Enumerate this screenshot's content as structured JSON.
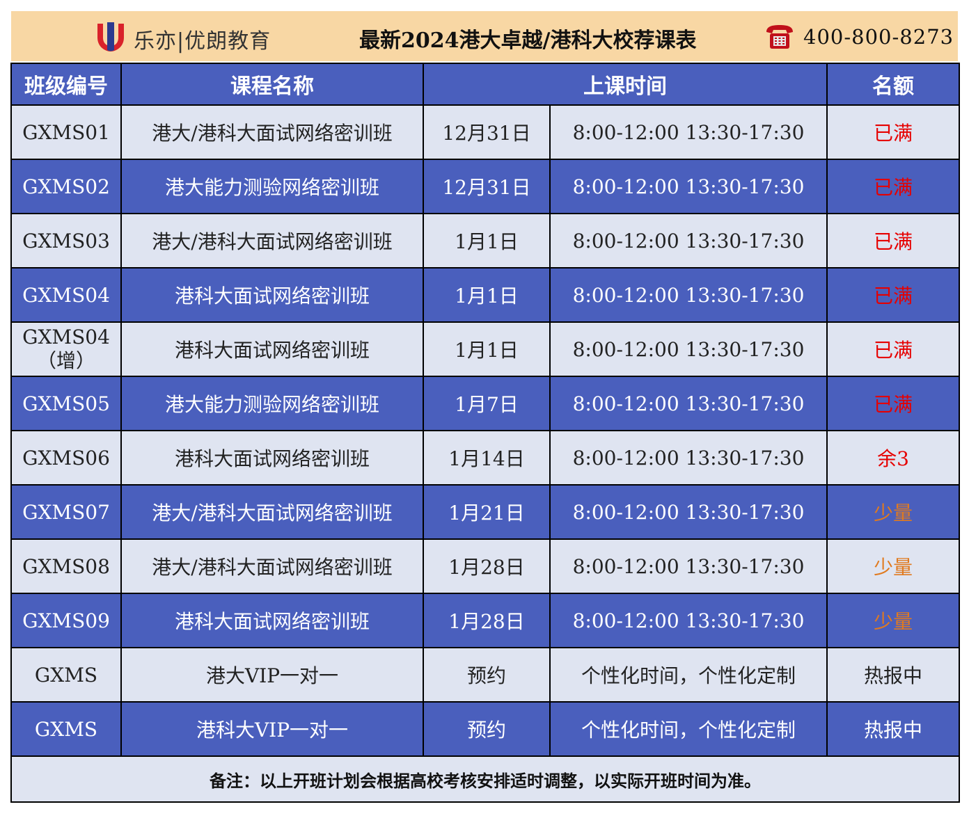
{
  "header": {
    "logo_text": "乐亦|优朗教育",
    "title": "最新2024港大卓越/港科大校荐课表",
    "phone": "400-800-8273",
    "icons": [
      "logo-icon",
      "telephone-icon"
    ]
  },
  "colors": {
    "header_bg": "#f8d7a4",
    "dark_row": "#4a5fbd",
    "light_row": "#dfe4f1",
    "status_full": "#e60000",
    "status_few": "#e07a1f"
  },
  "table": {
    "headers": [
      "班级编号",
      "课程名称",
      "上课时间",
      "名额"
    ],
    "rows": [
      {
        "id": "GXMS01",
        "id_sub": "",
        "course": "港大/港科大面试网络密训班",
        "date": "12月31日",
        "time": "8:00-12:00 13:30-17:30",
        "quota": "已满"
      },
      {
        "id": "GXMS02",
        "id_sub": "",
        "course": "港大能力测验网络密训班",
        "date": "12月31日",
        "time": "8:00-12:00 13:30-17:30",
        "quota": "已满"
      },
      {
        "id": "GXMS03",
        "id_sub": "",
        "course": "港大/港科大面试网络密训班",
        "date": "1月1日",
        "time": "8:00-12:00 13:30-17:30",
        "quota": "已满"
      },
      {
        "id": "GXMS04",
        "id_sub": "",
        "course": "港科大面试网络密训班",
        "date": "1月1日",
        "time": "8:00-12:00 13:30-17:30",
        "quota": "已满"
      },
      {
        "id": "GXMS04",
        "id_sub": "（增）",
        "course": "港科大面试网络密训班",
        "date": "1月1日",
        "time": "8:00-12:00 13:30-17:30",
        "quota": "已满"
      },
      {
        "id": "GXMS05",
        "id_sub": "",
        "course": "港大能力测验网络密训班",
        "date": "1月7日",
        "time": "8:00-12:00 13:30-17:30",
        "quota": "已满"
      },
      {
        "id": "GXMS06",
        "id_sub": "",
        "course": "港科大面试网络密训班",
        "date": "1月14日",
        "time": "8:00-12:00 13:30-17:30",
        "quota": "余3"
      },
      {
        "id": "GXMS07",
        "id_sub": "",
        "course": "港大/港科大面试网络密训班",
        "date": "1月21日",
        "time": "8:00-12:00 13:30-17:30",
        "quota": "少量"
      },
      {
        "id": "GXMS08",
        "id_sub": "",
        "course": "港大/港科大面试网络密训班",
        "date": "1月28日",
        "time": "8:00-12:00 13:30-17:30",
        "quota": "少量"
      },
      {
        "id": "GXMS09",
        "id_sub": "",
        "course": "港科大面试网络密训班",
        "date": "1月28日",
        "time": "8:00-12:00 13:30-17:30",
        "quota": "少量"
      },
      {
        "id": "GXMS",
        "id_sub": "",
        "course": "港大VIP一对一",
        "date": "预约",
        "time": "个性化时间，个性化定制",
        "quota": "热报中"
      },
      {
        "id": "GXMS",
        "id_sub": "",
        "course": "港科大VIP一对一",
        "date": "预约",
        "time": "个性化时间，个性化定制",
        "quota": "热报中"
      }
    ],
    "note": "备注：以上开班计划会根据高校考核安排适时调整，以实际开班时间为准。"
  }
}
